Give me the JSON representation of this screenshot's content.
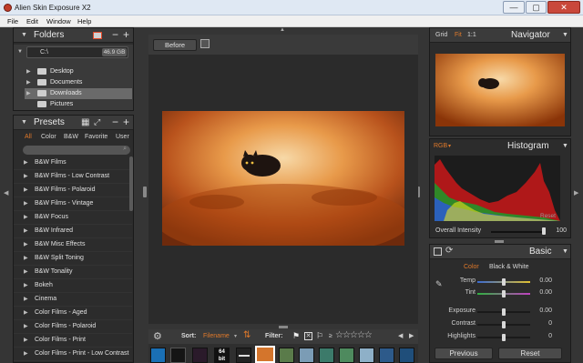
{
  "window": {
    "title": "Alien Skin Exposure X2",
    "controls": [
      "—",
      "▢",
      "✕"
    ]
  },
  "menu": [
    "File",
    "Edit",
    "Window",
    "Help"
  ],
  "folders": {
    "title": "Folders",
    "drive": {
      "label": "C:\\",
      "size": "46.9 GB"
    },
    "items": [
      {
        "label": "Desktop",
        "selected": false
      },
      {
        "label": "Documents",
        "selected": false
      },
      {
        "label": "Downloads",
        "selected": true
      },
      {
        "label": "Pictures",
        "selected": false
      }
    ]
  },
  "presets": {
    "title": "Presets",
    "tabs": [
      "All",
      "Color",
      "B&W",
      "Favorite",
      "User"
    ],
    "active_tab": "All",
    "items": [
      "B&W Films",
      "B&W Films - Low Contrast",
      "B&W Films - Polaroid",
      "B&W Films - Vintage",
      "B&W Focus",
      "B&W Infrared",
      "B&W Misc Effects",
      "B&W Split Toning",
      "B&W Tonality",
      "Bokeh",
      "Cinema",
      "Color Films - Aged",
      "Color Films - Polaroid",
      "Color Films - Print",
      "Color Films - Print - Low Contrast"
    ]
  },
  "center": {
    "before_label": "Before",
    "sort_label": "Sort:",
    "sort_value": "Filename",
    "filter_label": "Filter:",
    "rating_prefix": "≥",
    "thumb_badge": "64 bit"
  },
  "navigator": {
    "title": "Navigator",
    "zoom_options": [
      "Grid",
      "Fit",
      "1:1"
    ],
    "active_zoom": "Fit"
  },
  "histogram": {
    "title": "Histogram",
    "mode": "RGB",
    "reset_label": "Reset"
  },
  "overall_intensity": {
    "label": "Overall Intensity",
    "value": "100",
    "level": 1.0
  },
  "basic": {
    "title": "Basic",
    "mode_tabs": [
      "Color",
      "Black & White"
    ],
    "active_mode": "Color",
    "sliders": [
      {
        "label": "Temp",
        "value": "0.00",
        "position": 0.5
      },
      {
        "label": "Tint",
        "value": "0.00",
        "position": 0.5
      },
      {
        "label": "Exposure",
        "value": "0.00",
        "position": 0.5
      },
      {
        "label": "Contrast",
        "value": "0",
        "position": 0.5
      },
      {
        "label": "Highlights",
        "value": "0",
        "position": 0.5
      }
    ],
    "previous_label": "Previous",
    "reset_label": "Reset"
  },
  "colors": {
    "accent": "#e0792a",
    "panel": "#2c2c2c",
    "background": "#353535"
  }
}
